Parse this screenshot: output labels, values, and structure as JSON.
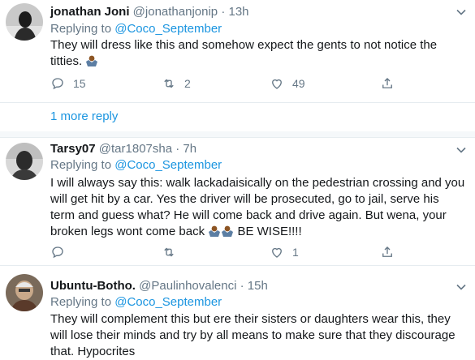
{
  "replying_prefix": "Replying to",
  "tweets": [
    {
      "name": "jonathan Joni",
      "handle": "@jonathanjonip",
      "time": "13h",
      "reply_to": "@Coco_September",
      "text_lines": [
        "They will dress like this and somehow expect the gents to not notice the",
        "titties."
      ],
      "replies": "15",
      "retweets": "2",
      "likes": "49"
    },
    {
      "name": "Tarsy07",
      "handle": "@tar1807sha",
      "time": "7h",
      "reply_to": "@Coco_September",
      "text_lines": [
        "I will always say this: walk lackadaisically on the pedestrian crossing and you",
        "will get hit by a car. Yes the driver will be prosecuted, go to jail, serve his",
        "term and guess what? He will come back and drive again. But wena, your",
        "broken legs wont come back",
        "BE WISE!!!!"
      ],
      "replies": "",
      "retweets": "",
      "likes": "1"
    },
    {
      "name": "Ubuntu-Botho.",
      "handle": "@Paulinhovalenci",
      "time": "15h",
      "reply_to": "@Coco_September",
      "text_lines": [
        "They will complement this but ere their sisters or daughters wear this, they",
        "will lose their minds and try by all means to make sure that they discourage",
        "that. Hypocrites"
      ]
    }
  ],
  "more_replies": "1 more reply",
  "dot": "·",
  "colors": {
    "link": "#1b95e0",
    "muted": "#657786",
    "divider": "#e6ecf0",
    "gap": "#f5f8fa"
  },
  "icons": [
    "reply-icon",
    "retweet-icon",
    "like-icon",
    "share-icon",
    "caret-down-icon",
    "man-shrugging-emoji"
  ]
}
